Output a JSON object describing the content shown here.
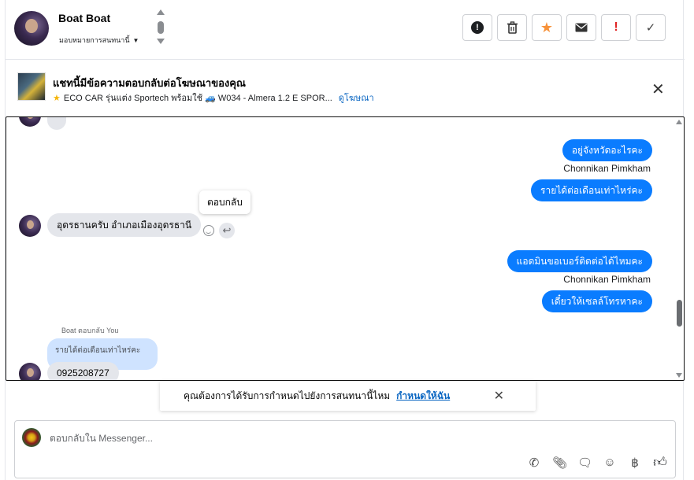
{
  "header": {
    "contact_name": "Boat Boat",
    "assign_label": "มอบหมายการสนทนานี้"
  },
  "actions": [
    {
      "name": "spam-button",
      "icon": "alert-circle-icon"
    },
    {
      "name": "delete-button",
      "icon": "trash-icon"
    },
    {
      "name": "star-button",
      "icon": "star-icon"
    },
    {
      "name": "mark-unread-button",
      "icon": "envelope-icon"
    },
    {
      "name": "follow-up-button",
      "icon": "exclamation-icon"
    },
    {
      "name": "done-button",
      "icon": "check-icon"
    }
  ],
  "ad": {
    "title": "แชทนี้มีข้อความตอบกลับต่อโฆษณาของคุณ",
    "subtitle": "ECO CAR รุ่นแต่ง Sportech พร้อมใช้ 🚙 W034 - Almera 1.2 E SPOR...",
    "link": "ดูโฆษณา"
  },
  "messages": {
    "out1": "อยู่จังหวัดอะไรคะ",
    "sender1": "Chonnikan Pimkham",
    "out2": "รายได้ต่อเดือนเท่าไหร่คะ",
    "in1": "อุดรธานครับ อำเภอเมืองอุดรธานี",
    "tooltip": "ตอบกลับ",
    "out3": "แอดมินขอเบอร์ติดต่อได้ไหมคะ",
    "sender2": "Chonnikan Pimkham",
    "out4": "เดี๋ยวให้เซลล์โทรหาคะ",
    "reply_label": "Boat ตอบกลับ You",
    "quoted": "รายได้ต่อเดือนเท่าไหร่คะ",
    "in2": "0925208727"
  },
  "reminder": {
    "text": "คุณต้องการได้รับการกำหนดไปยังการสนทนานี้ไหม",
    "action": "กำหนดให้ฉัน"
  },
  "composer": {
    "placeholder": "ตอบกลับใน Messenger..."
  },
  "colors": {
    "outgoing_bubble": "#0a7cff",
    "incoming_bubble": "#e4e6eb",
    "link": "#0a66c2",
    "star": "#f7923a"
  }
}
